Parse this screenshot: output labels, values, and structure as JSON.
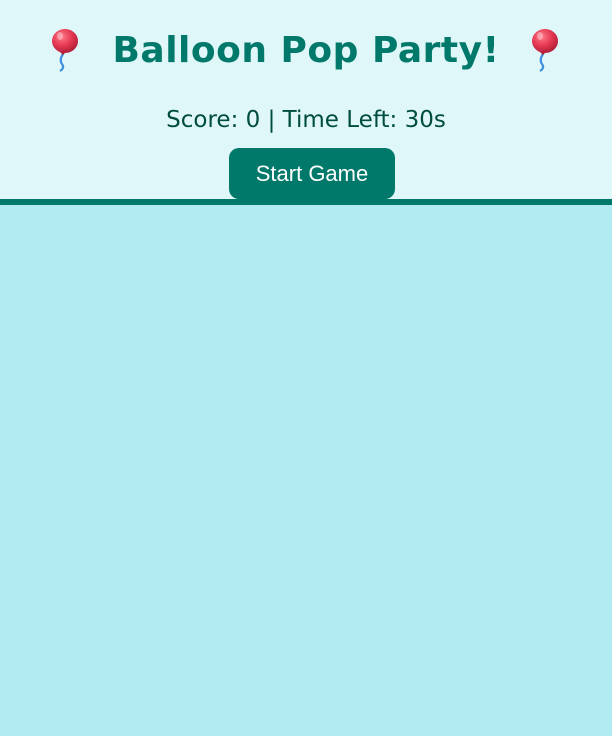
{
  "header": {
    "title": "Balloon Pop Party!",
    "left_icon": "balloon-icon",
    "right_icon": "balloon-icon"
  },
  "status": {
    "score_label": "Score:",
    "score": 0,
    "separator": "|",
    "time_label": "Time Left:",
    "time_left": "30s"
  },
  "controls": {
    "start_label": "Start Game"
  },
  "colors": {
    "header_bg": "#e0f7fa",
    "accent": "#00796b",
    "status_text": "#004d40",
    "play_area_bg": "#b2ebf2",
    "balloon": "#e53950"
  }
}
